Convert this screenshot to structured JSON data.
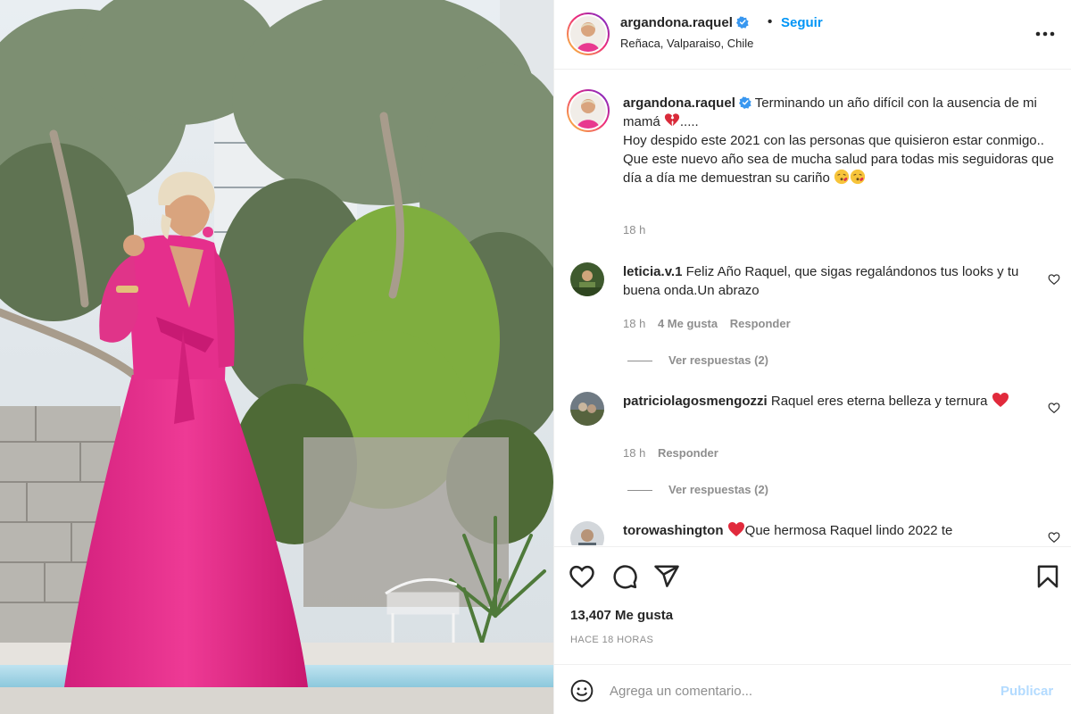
{
  "photo": {
    "alt_icon": "post-photo"
  },
  "header": {
    "username": "argandona.raquel",
    "dot": "•",
    "follow_label": "Seguir",
    "location": "Reñaca, Valparaiso, Chile",
    "more_icon": "more-options-icon"
  },
  "caption": {
    "username": "argandona.raquel",
    "line1": "Terminando un año difícil con la ausencia de mi mamá",
    "line1_end": ".....",
    "line2": "Hoy despido este 2021 con las personas que quisieron estar conmigo..",
    "line3": "Que este nuevo año sea de mucha salud para todas mis seguidoras que día a día me demuestran su cariño",
    "time": "18 h"
  },
  "comments": [
    {
      "username": "leticia.v.1",
      "text": "Feliz Año Raquel, que sigas regalándonos tus looks y tu buena onda.Un abrazo",
      "time": "18 h",
      "likes": "4 Me gusta",
      "reply_label": "Responder",
      "view_replies": "Ver respuestas (2)"
    },
    {
      "username": "patriciolagosmengozzi",
      "text": "Raquel eres eterna belleza y ternura",
      "time": "18 h",
      "reply_label": "Responder",
      "view_replies": "Ver respuestas (2)"
    },
    {
      "username": "torowashington",
      "text": "Que hermosa Raquel lindo 2022 te"
    }
  ],
  "actions": {
    "likes_count": "13,407 Me gusta",
    "time_ago": "HACE 18 HORAS"
  },
  "add_comment": {
    "placeholder": "Agrega un comentario...",
    "publish_label": "Publicar"
  },
  "colors": {
    "accent": "#0095f6",
    "dress": "#e8308e",
    "heart_red": "#ed4956",
    "muted": "#8e8e8e"
  }
}
